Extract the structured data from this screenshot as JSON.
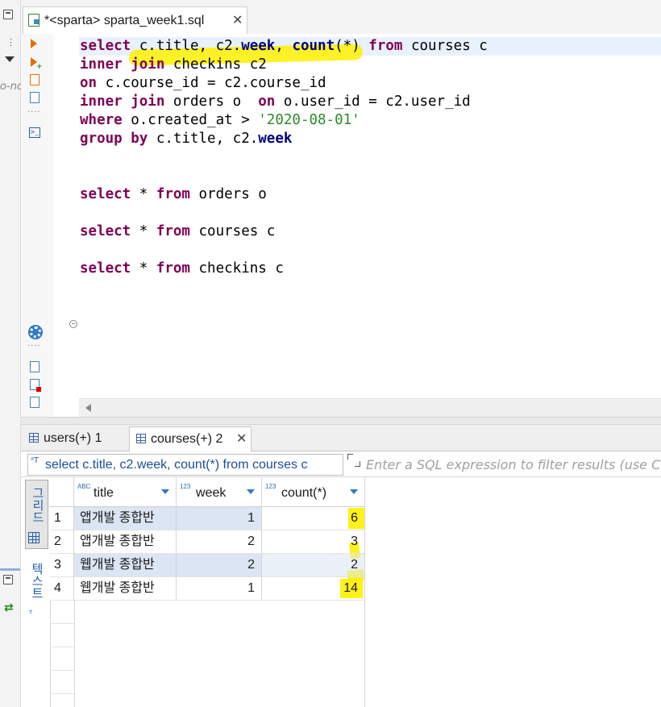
{
  "editor_tab": {
    "label": "*<sparta> sparta_week1.sql",
    "close": "✕"
  },
  "left_edge": {
    "clipped_text": "o-nc"
  },
  "editor": {
    "lines": [
      [
        {
          "t": "select ",
          "c": "kw"
        },
        {
          "t": "c.title, c2.",
          "c": ""
        },
        {
          "t": "week",
          "c": "fn"
        },
        {
          "t": ", ",
          "c": ""
        },
        {
          "t": "count",
          "c": "fn"
        },
        {
          "t": "(*) ",
          "c": ""
        },
        {
          "t": "from",
          "c": "kw"
        },
        {
          "t": " courses c",
          "c": ""
        }
      ],
      [
        {
          "t": "inner join",
          "c": "kw"
        },
        {
          "t": " checkins c2",
          "c": ""
        }
      ],
      [
        {
          "t": "on",
          "c": "kw"
        },
        {
          "t": " c.course_id = c2.course_id",
          "c": ""
        }
      ],
      [
        {
          "t": "inner join",
          "c": "kw"
        },
        {
          "t": " orders o  ",
          "c": ""
        },
        {
          "t": "on",
          "c": "kw"
        },
        {
          "t": " o.user_id = c2.user_id",
          "c": ""
        }
      ],
      [
        {
          "t": "where",
          "c": "kw"
        },
        {
          "t": " o.created_at > ",
          "c": ""
        },
        {
          "t": "'2020-08-01'",
          "c": "str"
        }
      ],
      [
        {
          "t": "group by",
          "c": "kw"
        },
        {
          "t": " c.title, c2.",
          "c": ""
        },
        {
          "t": "week",
          "c": "fn"
        }
      ],
      [],
      [],
      [
        {
          "t": "select",
          "c": "kw"
        },
        {
          "t": " * ",
          "c": ""
        },
        {
          "t": "from",
          "c": "kw"
        },
        {
          "t": " orders o",
          "c": ""
        }
      ],
      [],
      [
        {
          "t": "select",
          "c": "kw"
        },
        {
          "t": " * ",
          "c": ""
        },
        {
          "t": "from",
          "c": "kw"
        },
        {
          "t": " courses c",
          "c": ""
        }
      ],
      [],
      [
        {
          "t": "select",
          "c": "kw"
        },
        {
          "t": " * ",
          "c": ""
        },
        {
          "t": "from",
          "c": "kw"
        },
        {
          "t": " checkins c",
          "c": ""
        }
      ]
    ]
  },
  "result_tabs": [
    {
      "label": "users(+) 1"
    },
    {
      "label": "courses(+) 2",
      "close": "✕"
    }
  ],
  "filter": {
    "query_text": "select c.title, c2.week, count(*) from courses c",
    "placeholder": "Enter a SQL expression to filter results (use Ctrl+Space)"
  },
  "view_toggles": {
    "grid": "그리드",
    "text": "텍스트"
  },
  "table": {
    "columns": [
      {
        "name": "title",
        "type_icon": "ABC"
      },
      {
        "name": "week",
        "type_icon": "123"
      },
      {
        "name": "count(*)",
        "type_icon": "123"
      }
    ],
    "rows": [
      {
        "num": "1",
        "title": "앱개발 종합반",
        "week": "1",
        "count": "6"
      },
      {
        "num": "2",
        "title": "앱개발 종합반",
        "week": "2",
        "count": "3"
      },
      {
        "num": "3",
        "title": "웹개발 종합반",
        "week": "2",
        "count": "2"
      },
      {
        "num": "4",
        "title": "웹개발 종합반",
        "week": "1",
        "count": "14"
      }
    ]
  },
  "colors": {
    "keyword": "#7f0055",
    "function": "#000080",
    "string": "#2a8c2a",
    "highlighter": "#fff000",
    "selected_cell": "#dbe5f3"
  }
}
